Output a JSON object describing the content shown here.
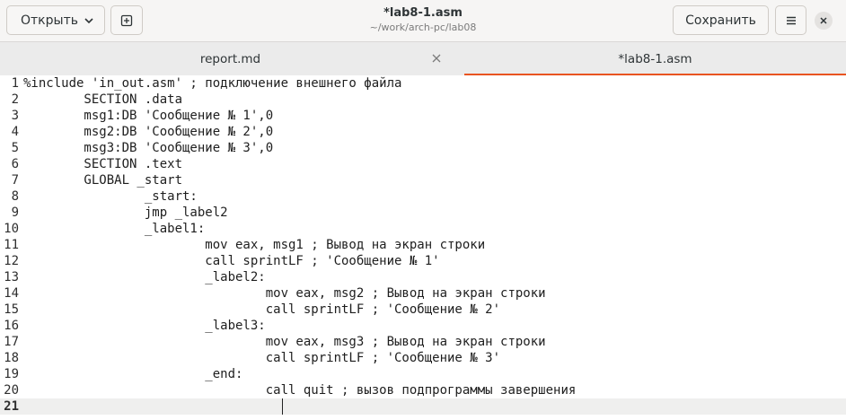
{
  "header": {
    "open_label": "Открыть",
    "save_label": "Сохранить",
    "title": "*lab8-1.asm",
    "subtitle": "~/work/arch-pc/lab08"
  },
  "tabs": [
    {
      "label": "report.md"
    },
    {
      "label": "*lab8-1.asm"
    }
  ],
  "editor": {
    "lines": [
      {
        "n": "1",
        "text": "%include 'in_out.asm' ; подключение внешнего файла"
      },
      {
        "n": "2",
        "text": "        SECTION .data"
      },
      {
        "n": "3",
        "text": "        msg1:DB 'Сообщение № 1',0"
      },
      {
        "n": "4",
        "text": "        msg2:DB 'Сообщение № 2',0"
      },
      {
        "n": "5",
        "text": "        msg3:DB 'Сообщение № 3',0"
      },
      {
        "n": "6",
        "text": "        SECTION .text"
      },
      {
        "n": "7",
        "text": "        GLOBAL _start"
      },
      {
        "n": "8",
        "text": "                _start:"
      },
      {
        "n": "9",
        "text": "                jmp _label2"
      },
      {
        "n": "10",
        "text": "                _label1:"
      },
      {
        "n": "11",
        "text": "                        mov eax, msg1 ; Вывод на экран строки"
      },
      {
        "n": "12",
        "text": "                        call sprintLF ; 'Сообщение № 1'"
      },
      {
        "n": "13",
        "text": "                        _label2:"
      },
      {
        "n": "14",
        "text": "                                mov eax, msg2 ; Вывод на экран строки"
      },
      {
        "n": "15",
        "text": "                                call sprintLF ; 'Сообщение № 2'"
      },
      {
        "n": "16",
        "text": "                        _label3:"
      },
      {
        "n": "17",
        "text": "                                mov eax, msg3 ; Вывод на экран строки"
      },
      {
        "n": "18",
        "text": "                                call sprintLF ; 'Сообщение № 3'"
      },
      {
        "n": "19",
        "text": "                        _end:"
      },
      {
        "n": "20",
        "text": "                                call quit ; вызов подпрограммы завершения"
      },
      {
        "n": "21",
        "text": ""
      }
    ]
  },
  "icons": {
    "open_dropdown": "chevron-down-icon",
    "new_tab": "new-tab-icon",
    "menu": "hamburger-menu-icon",
    "close_window": "close-icon",
    "close_tab": "close-icon"
  },
  "colors": {
    "accent": "#e95420",
    "headerbar": "#f6f5f4",
    "tabbar": "#ebebeb",
    "current_line": "#efefee"
  }
}
